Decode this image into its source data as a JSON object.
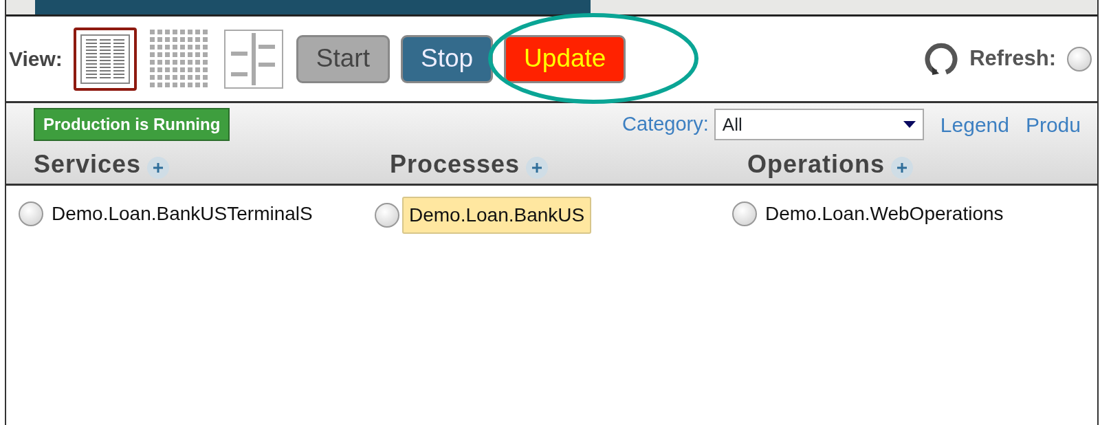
{
  "toolbar": {
    "view_label": "View:",
    "view_modes": [
      {
        "kind": "list",
        "selected": true
      },
      {
        "kind": "grid",
        "selected": false
      },
      {
        "kind": "split",
        "selected": false
      }
    ],
    "buttons": [
      {
        "label": "Start",
        "kind": "neutral"
      },
      {
        "label": "Stop",
        "kind": "primary"
      },
      {
        "label": "Update",
        "kind": "alert",
        "highlighted": true
      }
    ],
    "refresh_label": "Refresh:",
    "refresh_option": {
      "selected": false
    }
  },
  "status": {
    "label": "Production is Running"
  },
  "filter": {
    "label": "Category:",
    "value": "All"
  },
  "links": [
    "Legend",
    "Produ"
  ],
  "columns": [
    {
      "title": "Services",
      "items": [
        {
          "label": "Demo.Loan.BankUSTerminalS",
          "selected": false
        }
      ]
    },
    {
      "title": "Processes",
      "items": [
        {
          "label": "Demo.Loan.BankUS",
          "selected": true
        }
      ]
    },
    {
      "title": "Operations",
      "items": [
        {
          "label": "Demo.Loan.WebOperations",
          "selected": false
        }
      ]
    }
  ]
}
